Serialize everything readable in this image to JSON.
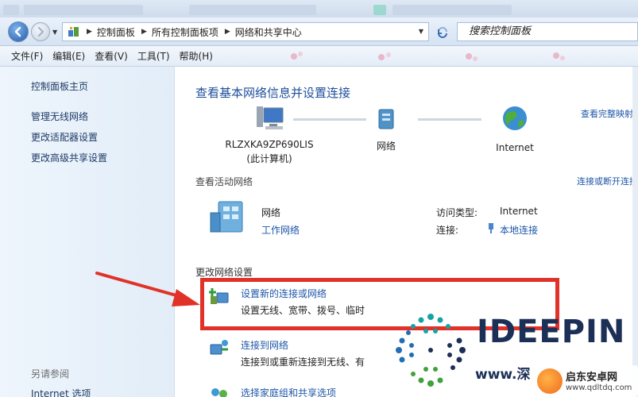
{
  "window": {
    "breadcrumbs": [
      "控制面板",
      "所有控制面板项",
      "网络和共享中心"
    ],
    "search_placeholder": "搜索控制面板"
  },
  "menu": [
    "文件(F)",
    "编辑(E)",
    "查看(V)",
    "工具(T)",
    "帮助(H)"
  ],
  "sidebar": {
    "items": [
      {
        "label": "控制面板主页"
      },
      {
        "label": "管理无线网络"
      },
      {
        "label": "更改适配器设置"
      },
      {
        "label": "更改高级共享设置"
      }
    ],
    "see_also": "另请参阅",
    "see_also_item": "Internet 选项"
  },
  "main": {
    "title": "查看基本网络信息并设置连接",
    "view_full_map": "查看完整映射",
    "map": {
      "computer_name": "RLZXKA9ZP690LIS",
      "computer_sub": "(此计算机)",
      "network": "网络",
      "internet": "Internet"
    },
    "active_networks_title": "查看活动网络",
    "connect_disconnect": "连接或断开连接",
    "active_network": {
      "name": "网络",
      "type": "工作网络",
      "access_label": "访问类型:",
      "access_value": "Internet",
      "connections_label": "连接:",
      "connections_value": "本地连接"
    },
    "change_settings_title": "更改网络设置",
    "tasks": [
      {
        "link": "设置新的连接或网络",
        "desc": "设置无线、宽带、拨号、临时"
      },
      {
        "link": "连接到网络",
        "desc": "连接到或重新连接到无线、有"
      },
      {
        "link": "选择家庭组和共享选项",
        "desc": ""
      }
    ]
  },
  "watermarks": {
    "brand": "IDEEPIN",
    "brand_url": "www.深",
    "site_name": "启东安卓网",
    "site_url": "www.qdltdq.com"
  },
  "colors": {
    "link": "#1e56a8",
    "title": "#1f4e9c",
    "highlight": "#e03229"
  }
}
